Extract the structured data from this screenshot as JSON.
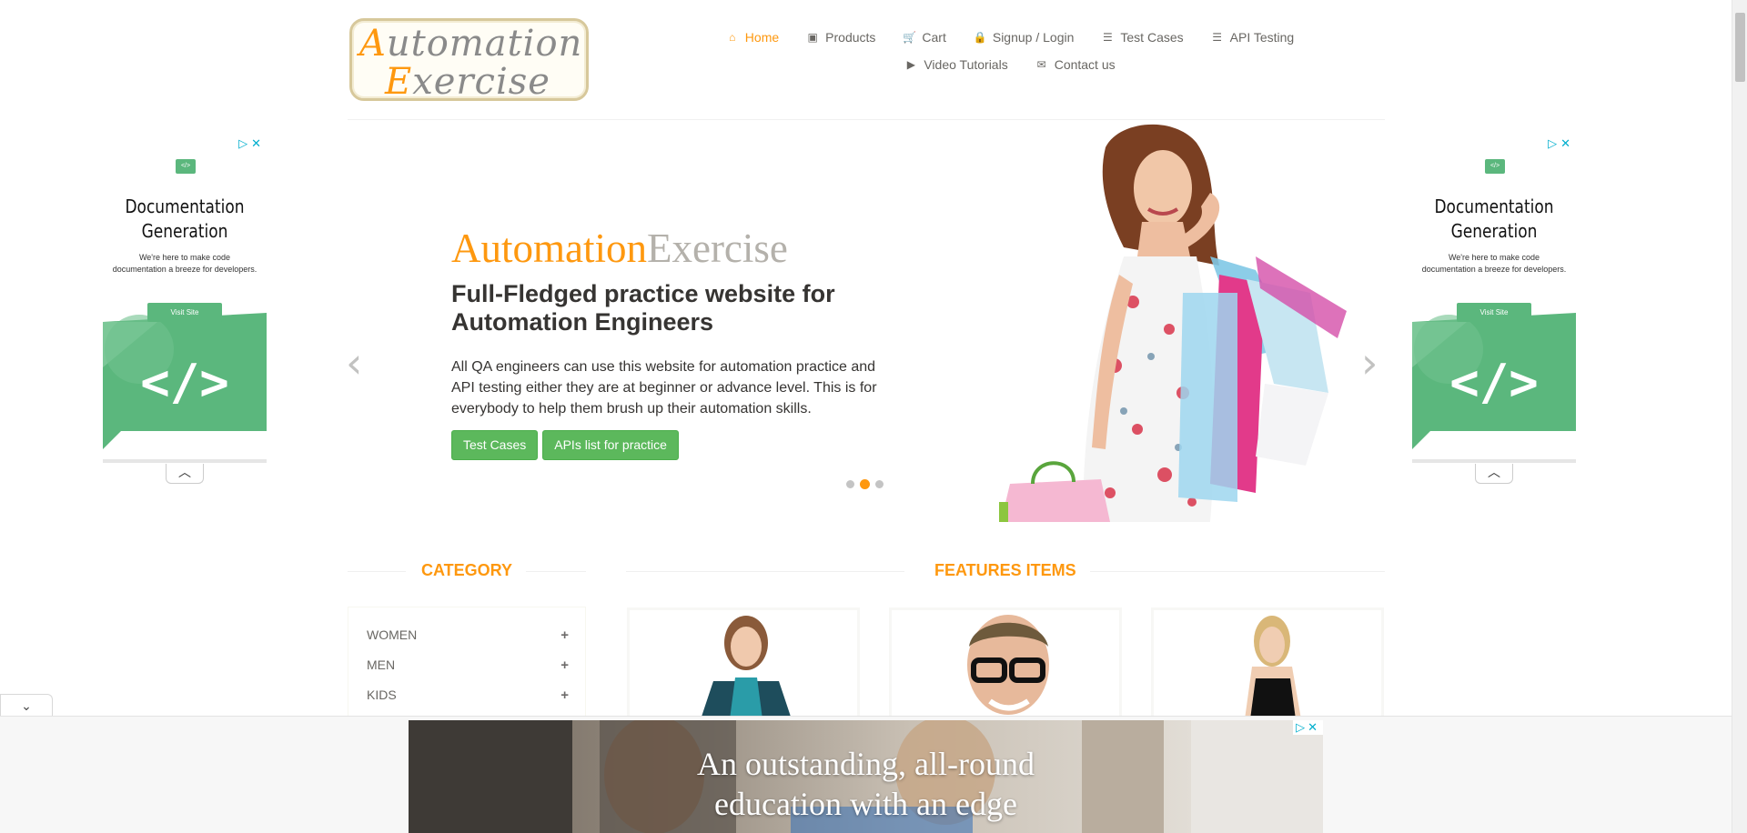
{
  "logo": {
    "line1_cap": "A",
    "line1_rest": "utomation",
    "line2_cap": "E",
    "line2_rest": "xercise"
  },
  "nav": {
    "row1": [
      {
        "icon": "home-icon",
        "glyph": "⌂",
        "label": "Home",
        "active": true
      },
      {
        "icon": "products-icon",
        "glyph": "▣",
        "label": "Products"
      },
      {
        "icon": "cart-icon",
        "glyph": "🛒",
        "label": "Cart"
      },
      {
        "icon": "lock-icon",
        "glyph": "🔒",
        "label": "Signup / Login"
      },
      {
        "icon": "list-icon",
        "glyph": "☰",
        "label": "Test Cases"
      },
      {
        "icon": "list-icon",
        "glyph": "☰",
        "label": "API Testing"
      }
    ],
    "row2": [
      {
        "icon": "youtube-icon",
        "glyph": "▶",
        "label": "Video Tutorials"
      },
      {
        "icon": "envelope-icon",
        "glyph": "✉",
        "label": "Contact us"
      }
    ]
  },
  "side_ad": {
    "badge": "</>",
    "title_line1": "Documentation",
    "title_line2": "Generation",
    "sub_line1": "We're here to make code",
    "sub_line2": "documentation a breeze for developers.",
    "button": "Visit Site",
    "art_code": "</>",
    "controls": "▷✕"
  },
  "hero": {
    "brand_a": "Automation",
    "brand_b": "Exercise",
    "heading": "Full-Fledged practice website for Automation Engineers",
    "paragraph": "All QA engineers can use this website for automation practice and API testing either they are at beginner or advance level. This is for everybody to help them brush up their automation skills.",
    "btn_test_cases": "Test Cases",
    "btn_apis": "APIs list for practice",
    "prev": "‹",
    "next": "›",
    "active_slide": 2,
    "slide_count": 3
  },
  "category": {
    "title": "CATEGORY",
    "items": [
      {
        "label": "WOMEN",
        "toggle": "+"
      },
      {
        "label": "MEN",
        "toggle": "+"
      },
      {
        "label": "KIDS",
        "toggle": "+"
      }
    ]
  },
  "features": {
    "title": "FEATURES ITEMS"
  },
  "bottom_ad": {
    "line1": "An outstanding, all-round",
    "line2": "education with an edge",
    "controls": "▷✕"
  },
  "collapse_toggle": "⌄",
  "colors": {
    "accent": "#fe980f",
    "button_green": "#5cb85c",
    "ad_green": "#5bb77d"
  }
}
